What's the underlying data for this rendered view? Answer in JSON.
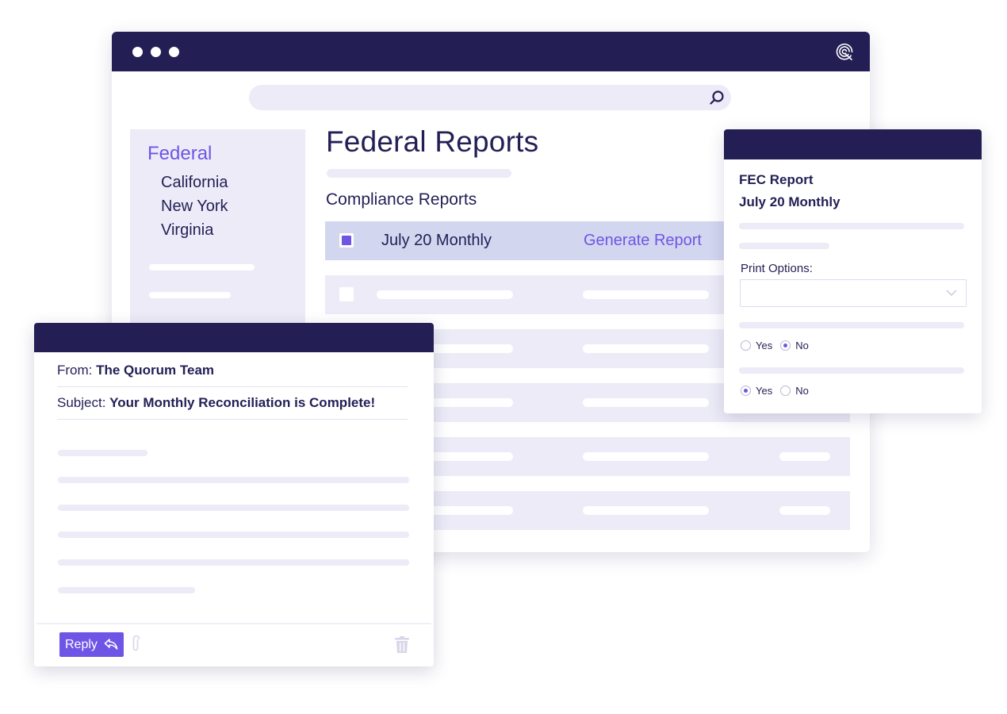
{
  "browser": {
    "logo_icon": "quorum-logo-icon",
    "search": {
      "icon": "search-icon"
    },
    "sidebar": {
      "active": "Federal",
      "items": [
        "California",
        "New York",
        "Virginia"
      ]
    },
    "page_title": "Federal Reports",
    "section_title": "Compliance Reports",
    "table": {
      "selected_row": {
        "checked": true,
        "name": "July 20 Monthly",
        "action": "Generate Report"
      }
    }
  },
  "fec_panel": {
    "title": "FEC Report",
    "subtitle": "July 20 Monthly",
    "print_options_label": "Print Options:",
    "select_value": "",
    "radio_group_1": {
      "options": [
        "Yes",
        "No"
      ],
      "selected": "No"
    },
    "radio_group_2": {
      "options": [
        "Yes",
        "No"
      ],
      "selected": "Yes"
    }
  },
  "email": {
    "from_label": "From:",
    "from_value": "The Quorum Team",
    "subject_label": "Subject:",
    "subject_value": "Your Monthly Reconciliation is Complete!",
    "reply_label": "Reply",
    "icons": [
      "reply-arrow-icon",
      "paperclip-icon",
      "trash-icon"
    ]
  },
  "colors": {
    "navy": "#231f55",
    "accent": "#6f55e6",
    "muted": "#ecebf7",
    "selected_row": "#d3d6ef"
  }
}
